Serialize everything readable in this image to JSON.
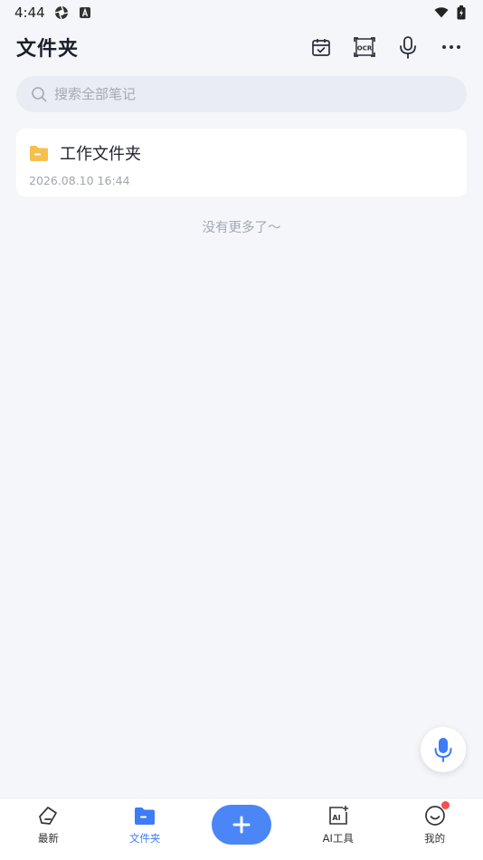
{
  "status_bar": {
    "time": "4:44"
  },
  "header": {
    "title": "文件夹"
  },
  "search": {
    "placeholder": "搜索全部笔记"
  },
  "folders": [
    {
      "name": "工作文件夹",
      "date": "2026.08.10 16:44"
    }
  ],
  "end_hint": "没有更多了～",
  "bottom_nav": {
    "recent": "最新",
    "folders": "文件夹",
    "ai_tools": "AI工具",
    "mine": "我的"
  },
  "colors": {
    "accent": "#4B86F7",
    "folder": "#F7C04E",
    "background": "#F4F6FA"
  }
}
